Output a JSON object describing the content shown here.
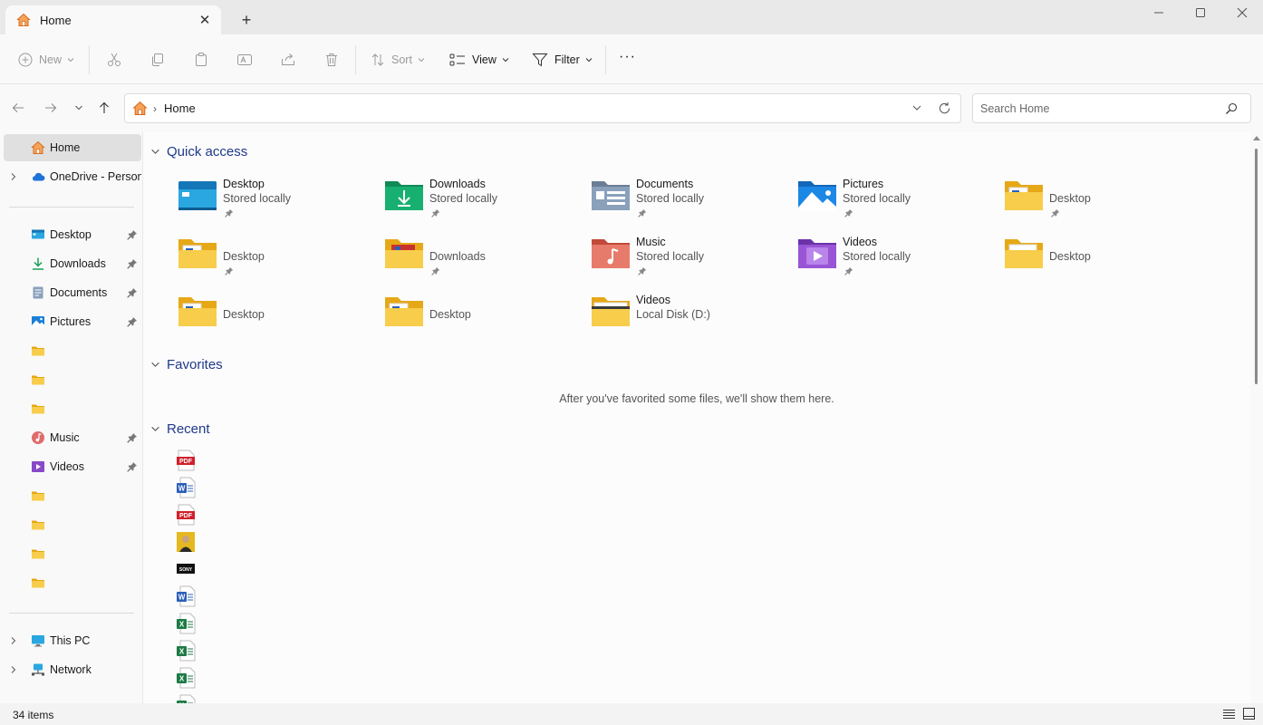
{
  "window": {
    "tab_title": "Home",
    "tab_icon": "home-icon",
    "new_tab_glyph": "+",
    "close_tab_glyph": "✕"
  },
  "toolbar": {
    "new_label": "New",
    "sort_label": "Sort",
    "view_label": "View",
    "filter_label": "Filter",
    "more_label": "···"
  },
  "address": {
    "crumb": "Home",
    "separator": "›"
  },
  "search": {
    "placeholder": "Search Home"
  },
  "sidebar": {
    "home": "Home",
    "onedrive": "OneDrive - Personal",
    "desktop": "Desktop",
    "downloads": "Downloads",
    "documents": "Documents",
    "pictures": "Pictures",
    "music": "Music",
    "videos": "Videos",
    "this_pc": "This PC",
    "network": "Network"
  },
  "main": {
    "quick_access": {
      "header": "Quick access",
      "items": [
        {
          "name": "Desktop",
          "sub": "Stored locally",
          "icon": "desktop-folder-icon",
          "pinned": true
        },
        {
          "name": "Downloads",
          "sub": "Stored locally",
          "icon": "downloads-folder-icon",
          "pinned": true
        },
        {
          "name": "Documents",
          "sub": "Stored locally",
          "icon": "documents-folder-icon",
          "pinned": true
        },
        {
          "name": "Pictures",
          "sub": "Stored locally",
          "icon": "pictures-folder-icon",
          "pinned": true
        },
        {
          "name": "",
          "sub": "Desktop",
          "icon": "folder-icon",
          "pinned": true
        },
        {
          "name": "",
          "sub": "Desktop",
          "icon": "folder-icon",
          "pinned": true
        },
        {
          "name": "",
          "sub": "Downloads",
          "icon": "folder-icon",
          "pinned": true
        },
        {
          "name": "Music",
          "sub": "Stored locally",
          "icon": "music-folder-icon",
          "pinned": true
        },
        {
          "name": "Videos",
          "sub": "Stored locally",
          "icon": "videos-folder-icon",
          "pinned": true
        },
        {
          "name": "",
          "sub": "Desktop",
          "icon": "folder-icon",
          "pinned": false
        },
        {
          "name": "",
          "sub": "Desktop",
          "icon": "folder-icon",
          "pinned": false
        },
        {
          "name": "",
          "sub": "Desktop",
          "icon": "folder-icon",
          "pinned": false
        },
        {
          "name": "Videos",
          "sub": "Local Disk (D:)",
          "icon": "folder-icon",
          "pinned": false
        }
      ]
    },
    "favorites": {
      "header": "Favorites",
      "empty_message": "After you've favorited some files, we'll show them here."
    },
    "recent": {
      "header": "Recent",
      "items": [
        "pdf-file-icon",
        "word-file-icon",
        "pdf-file-icon",
        "image-file-icon",
        "sony-file-icon",
        "word-file-icon",
        "excel-file-icon",
        "excel-file-icon",
        "excel-file-icon",
        "excel-file-icon"
      ]
    }
  },
  "status": {
    "count": "34 items"
  },
  "colors": {
    "accent_header": "#1f3a8a",
    "folder_yellow": "#f3c53f",
    "selection": "#e0e0e0"
  }
}
